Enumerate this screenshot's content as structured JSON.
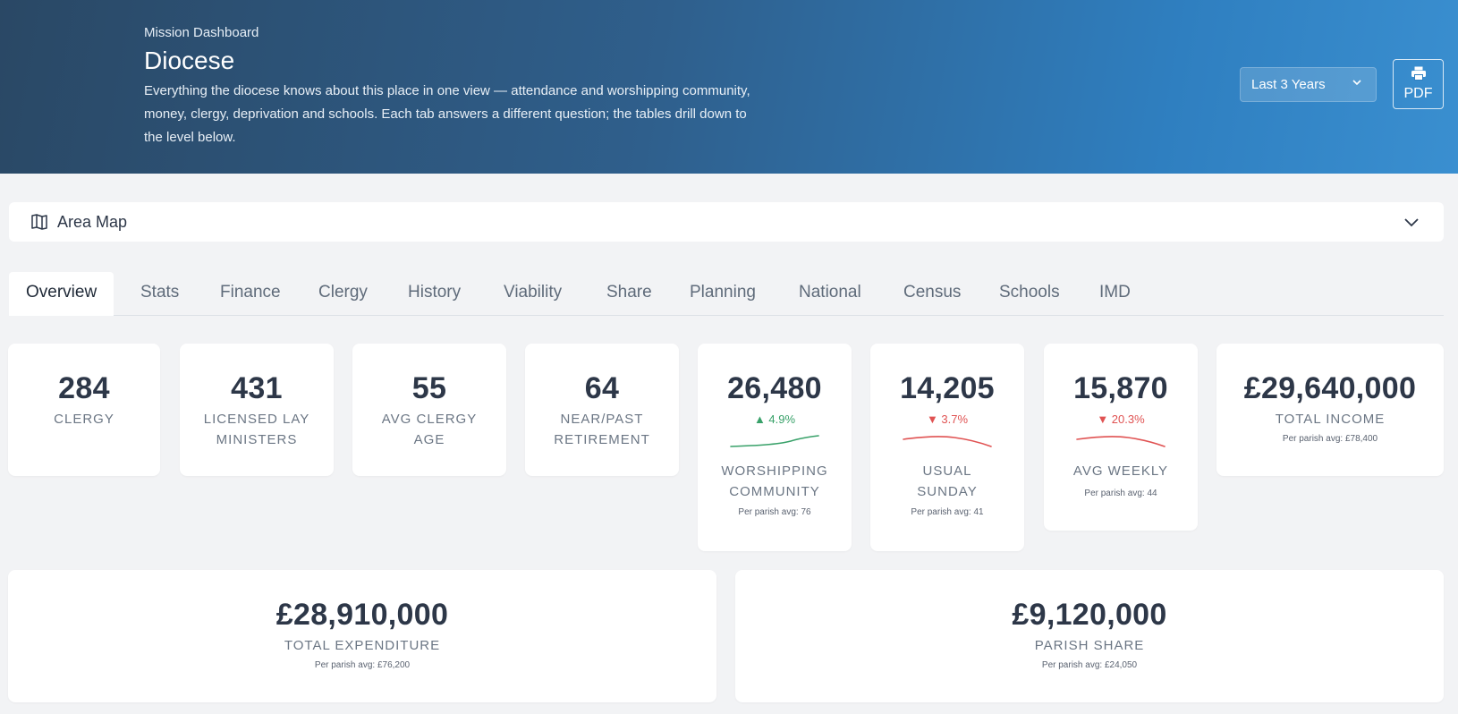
{
  "header": {
    "eyebrow": "Mission Dashboard",
    "title": "Diocese",
    "description": "Everything the diocese knows about this place in one view — attendance and worshipping community, money, clergy, deprivation and schools. Each tab answers a different question; the tables drill down to the level below.",
    "period_value": "Last 3 Years",
    "pdf_label": "PDF"
  },
  "map": {
    "label": "Area Map"
  },
  "tabs": [
    "Overview",
    "Stats",
    "Finance",
    "Clergy",
    "History",
    "Viability",
    "Share",
    "Planning",
    "National",
    "Census",
    "Schools",
    "IMD"
  ],
  "active_tab": "Overview",
  "colors": {
    "accent_up": "#38a169",
    "accent_down": "#e05252",
    "header_start": "#2a4865",
    "header_end": "#3a8fd0"
  },
  "stats": {
    "clergy": {
      "value": "284",
      "label": "CLERGY"
    },
    "lay": {
      "value": "431",
      "label_1": "LICENSED LAY",
      "label_2": "MINISTERS"
    },
    "age": {
      "value": "55",
      "label_1": "AVG CLERGY",
      "label_2": "AGE"
    },
    "retire": {
      "value": "64",
      "label_1": "NEAR/PAST",
      "label_2": "RETIREMENT"
    },
    "worship": {
      "value": "26,480",
      "delta": "▲ 4.9%",
      "trend": "up",
      "label_1": "WORSHIPPING",
      "label_2": "COMMUNITY",
      "sub": "Per parish avg: 76"
    },
    "sunday": {
      "value": "14,205",
      "delta": "▼ 3.7%",
      "trend": "down",
      "label_1": "USUAL",
      "label_2": "SUNDAY",
      "sub": "Per parish avg: 41"
    },
    "weekly": {
      "value": "15,870",
      "delta": "▼ 20.3%",
      "trend": "down",
      "label": "AVG WEEKLY",
      "sub": "Per parish avg: 44"
    },
    "income": {
      "value": "£29,640,000",
      "label": "TOTAL INCOME",
      "sub": "Per parish avg: £78,400"
    },
    "expenditure": {
      "value": "£28,910,000",
      "label": "TOTAL EXPENDITURE",
      "sub": "Per parish avg: £76,200"
    },
    "share": {
      "value": "£9,120,000",
      "label": "PARISH SHARE",
      "sub": "Per parish avg: £24,050"
    }
  }
}
